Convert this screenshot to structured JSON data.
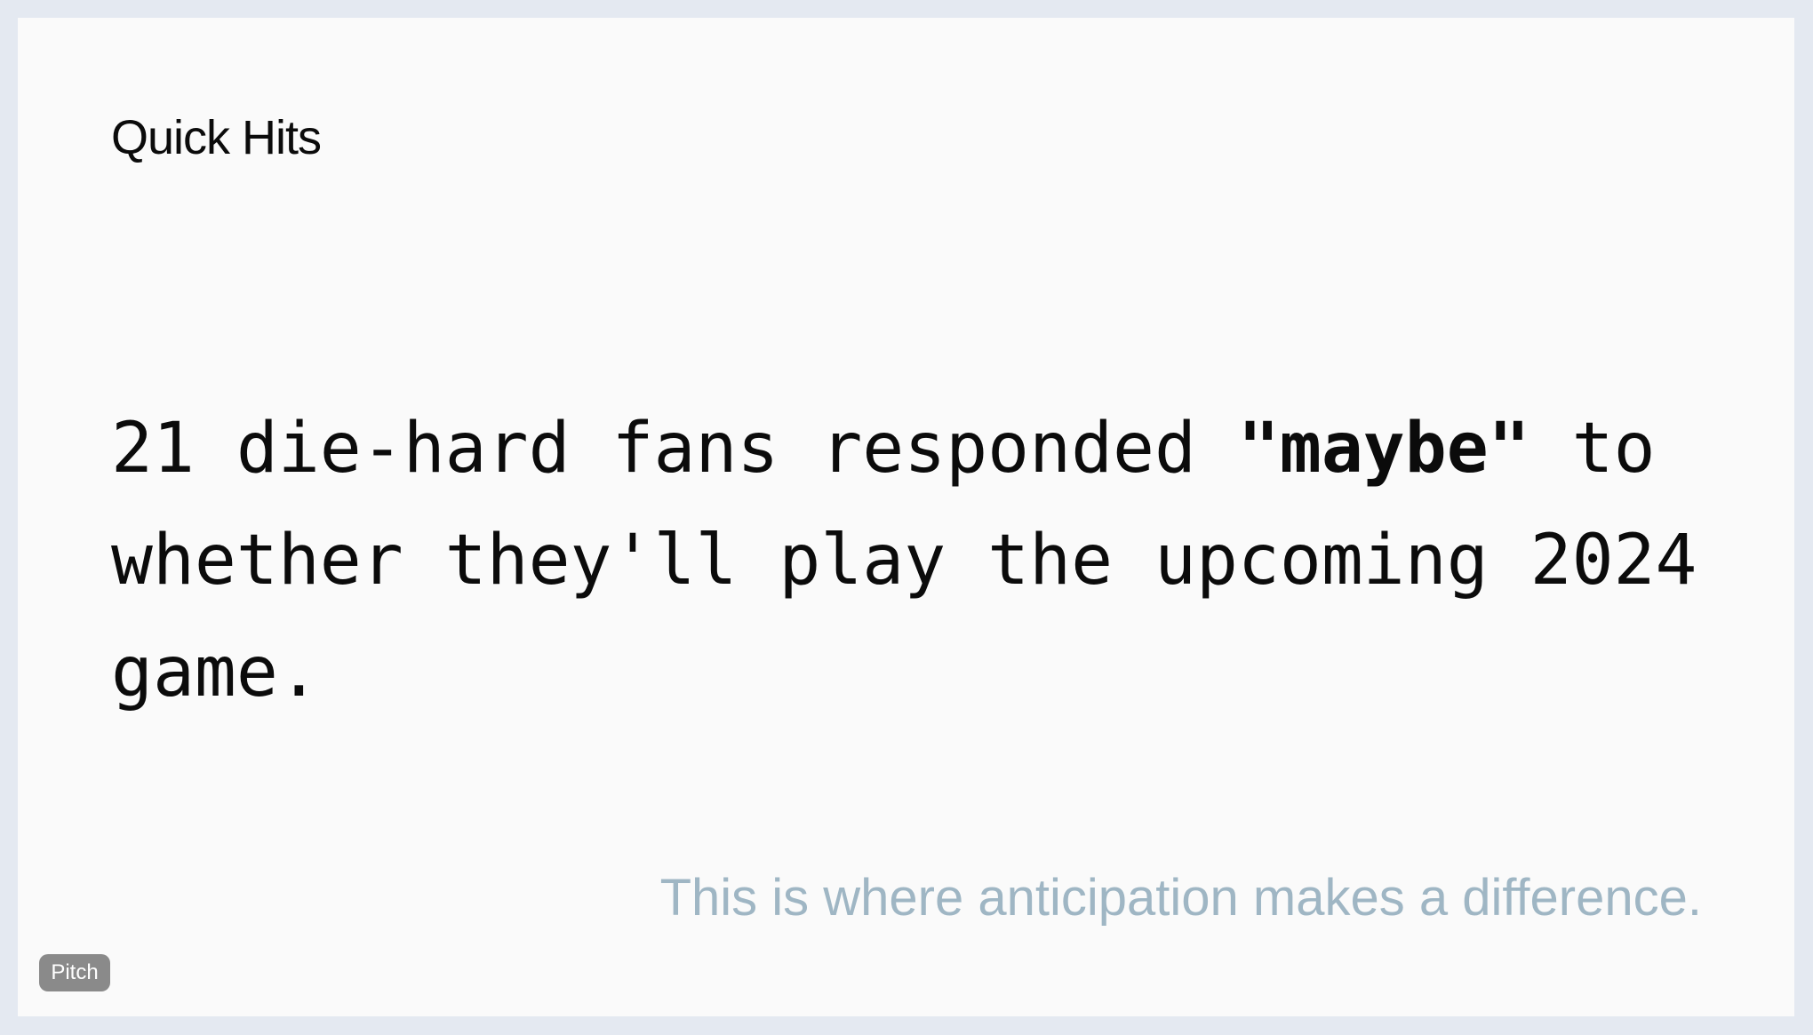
{
  "slide": {
    "title": "Quick Hits",
    "headline": {
      "before": "21 die-hard fans responded ",
      "emphasis": "\"maybe\"",
      "after": " to whether they'll play the upcoming 2024 game."
    },
    "subtext": "This is where anticipation makes a difference."
  },
  "badge": {
    "label": "Pitch"
  }
}
